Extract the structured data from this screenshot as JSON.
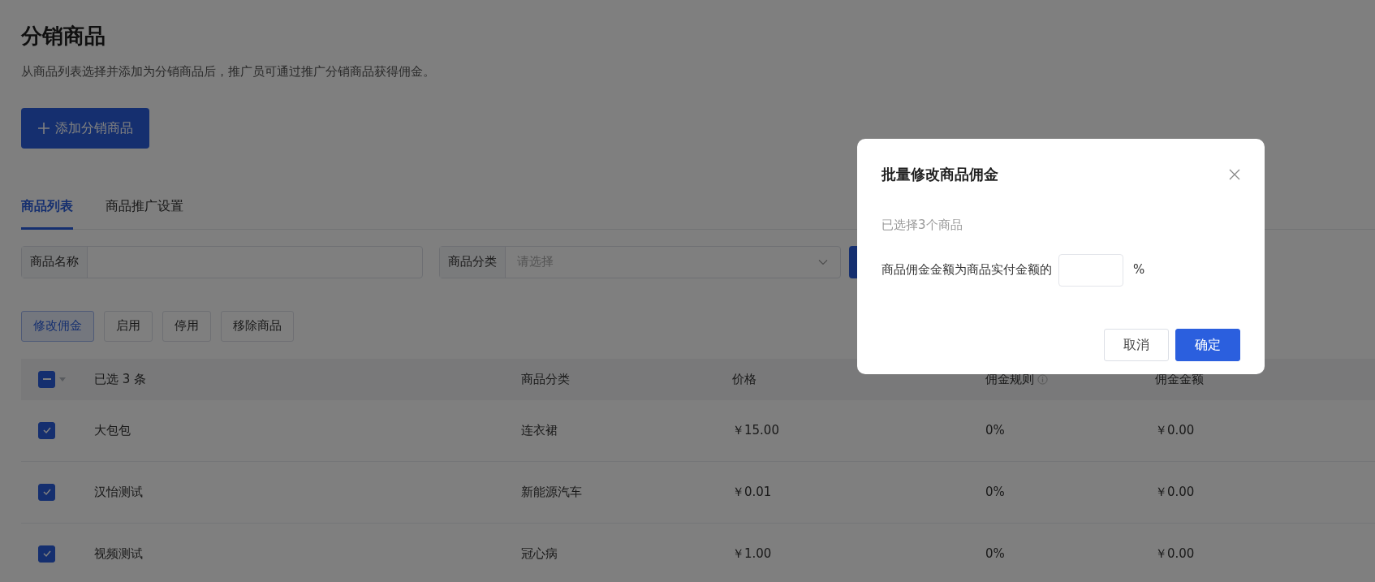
{
  "page": {
    "title": "分销商品",
    "subtitle": "从商品列表选择并添加为分销商品后，推广员可通过推广分销商品获得佣金。"
  },
  "add_button": {
    "label": "添加分销商品"
  },
  "tabs": [
    {
      "label": "商品列表",
      "selected": true
    },
    {
      "label": "商品推广设置",
      "selected": false
    }
  ],
  "filters": [
    {
      "kind": "text",
      "label": "商品名称"
    },
    {
      "kind": "select",
      "label": "商品分类",
      "placeholder": "请选择"
    }
  ],
  "actions": [
    {
      "label": "修改佣金",
      "selected": true
    },
    {
      "label": "启用",
      "selected": false
    },
    {
      "label": "停用",
      "selected": false
    },
    {
      "label": "移除商品",
      "selected": false
    }
  ],
  "table": {
    "select_all": {
      "indeterminate": true
    },
    "columns": [
      {
        "label": "已选 3 条"
      },
      {
        "label": "商品分类"
      },
      {
        "label": "价格"
      },
      {
        "label": "佣金规则",
        "info": true
      },
      {
        "label": "佣金金额"
      }
    ],
    "rows": [
      {
        "checked": true,
        "cells": [
          "大包包",
          "连衣裙",
          "￥15.00",
          "0%",
          "￥0.00"
        ]
      },
      {
        "checked": true,
        "cells": [
          "汉怡测试",
          "新能源汽车",
          "￥0.01",
          "0%",
          "￥0.00"
        ]
      },
      {
        "checked": true,
        "cells": [
          "视频测试",
          "冠心病",
          "￥1.00",
          "0%",
          "￥0.00"
        ]
      }
    ]
  },
  "modal": {
    "title": "批量修改商品佣金",
    "note": "已选择3个商品",
    "label": "商品佣金金额为商品实付金额的",
    "unit": "%",
    "buttons": [
      {
        "kind": "secondary",
        "label": "取消"
      },
      {
        "kind": "primary",
        "label": "确定"
      }
    ]
  }
}
